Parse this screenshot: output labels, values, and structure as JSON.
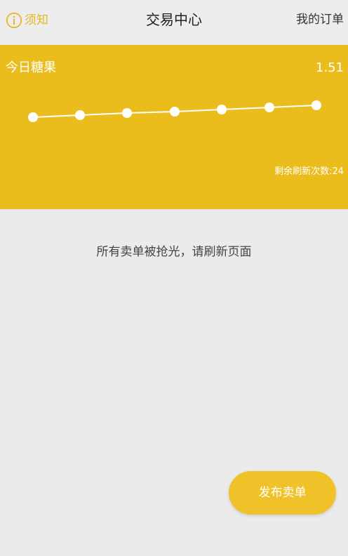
{
  "header": {
    "notice_label": "须知",
    "title": "交易中心",
    "orders_label": "我的订单"
  },
  "banner": {
    "title": "今日糖果",
    "value": "1.51",
    "refresh_text": "剩余刷新次数:24",
    "background": "#ebbd1c"
  },
  "main": {
    "empty_message": "所有卖单被抢光，请刷新页面"
  },
  "actions": {
    "publish_label": "发布卖单"
  },
  "colors": {
    "accent": "#e6b626",
    "button": "#f0c22a"
  },
  "icons": {
    "notice": "info-circle-icon"
  }
}
